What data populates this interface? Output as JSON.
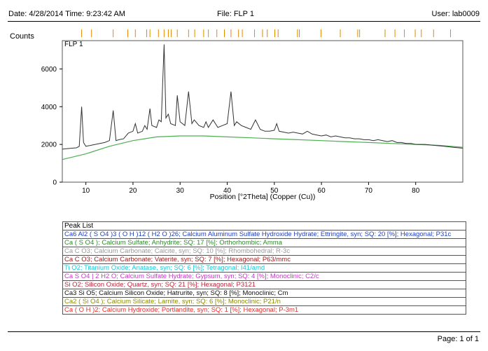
{
  "header": {
    "date": "Date: 4/28/2014 Time: 9:23:42 AM",
    "file": "File: FLP 1",
    "user": "User: lab0009"
  },
  "footer": {
    "page": "Page: 1 of 1"
  },
  "colors": {
    "pattern": "#333333",
    "background_curve": "#4caf50",
    "ref_ticks": "#e08a00",
    "axis": "#000000",
    "frame": "#555555"
  },
  "chart_data": {
    "type": "line",
    "title": "FLP 1",
    "ylabel": "Counts",
    "xlabel": "Position [°2Theta] (Copper (Cu))",
    "xlim": [
      5,
      90
    ],
    "ylim": [
      0,
      7500
    ],
    "xticks": [
      10,
      20,
      30,
      40,
      50,
      60,
      70,
      80
    ],
    "yticks": [
      0,
      2000,
      4000,
      6000
    ],
    "grid": false,
    "series": [
      {
        "x": [
          5,
          7,
          8,
          8.6,
          9.1,
          9.5,
          10,
          11,
          12,
          13,
          14,
          15,
          15.8,
          16.4,
          17,
          18,
          19,
          20,
          20.5,
          21,
          22,
          22.5,
          23,
          23.6,
          24,
          25,
          25.5,
          26,
          26.6,
          27,
          27.5,
          28,
          29,
          29.4,
          30,
          31,
          31.8,
          32.5,
          33,
          34,
          35,
          35.5,
          36,
          37,
          38,
          39,
          40,
          40.8,
          41.5,
          42,
          43,
          44,
          45,
          46,
          47,
          48,
          49,
          50,
          50.5,
          51,
          52,
          53,
          54,
          55,
          56,
          57,
          58,
          59,
          60,
          61,
          62,
          63,
          64,
          65,
          66,
          67,
          68,
          69,
          70,
          71,
          72,
          73,
          74,
          75,
          76,
          77,
          78,
          79,
          80,
          82,
          84,
          86,
          88,
          90
        ],
        "y": [
          1750,
          1800,
          1820,
          1900,
          4000,
          2100,
          1900,
          1950,
          2000,
          2050,
          2100,
          2200,
          3800,
          2200,
          2250,
          2300,
          2600,
          2700,
          3100,
          2600,
          2700,
          3000,
          2800,
          3900,
          3000,
          2900,
          3300,
          3200,
          7300,
          3400,
          3600,
          3100,
          3000,
          4600,
          3200,
          3000,
          4800,
          3100,
          3300,
          3000,
          2900,
          3200,
          2900,
          3300,
          2900,
          3000,
          3100,
          4800,
          3000,
          3200,
          3000,
          2900,
          2800,
          3300,
          2800,
          2700,
          2700,
          2750,
          3100,
          2700,
          2650,
          2600,
          2650,
          2600,
          2550,
          2700,
          2550,
          2500,
          2450,
          2500,
          2400,
          2450,
          2400,
          2350,
          2350,
          2300,
          2300,
          2250,
          2250,
          2200,
          2250,
          2200,
          2150,
          2200,
          2100,
          2100,
          2050,
          2050,
          2000,
          2000,
          1950,
          1900,
          1850,
          1800
        ]
      },
      {
        "x": [
          5,
          10,
          15,
          20,
          25,
          30,
          35,
          40,
          45,
          50,
          55,
          60,
          65,
          70,
          75,
          80,
          85,
          90
        ],
        "y": [
          1200,
          1500,
          1900,
          2200,
          2400,
          2450,
          2450,
          2400,
          2350,
          2300,
          2250,
          2200,
          2150,
          2100,
          2050,
          2000,
          1950,
          1850
        ]
      }
    ],
    "reference_ticks": [
      9.1,
      11.2,
      15.8,
      18.9,
      20.5,
      22.9,
      23.6,
      25.4,
      26.6,
      27.5,
      28.1,
      29.4,
      31.8,
      33.1,
      35.0,
      36.0,
      37.8,
      39.4,
      40.8,
      42.4,
      43.2,
      45.8,
      47.5,
      48.5,
      50.1,
      50.8,
      54.9,
      55.3,
      59.9,
      64.0,
      67.7,
      68.1,
      73.5,
      75.6,
      77.6,
      79.9,
      81.2,
      83.8,
      87.4
    ]
  },
  "peak_list": {
    "title": "Peak List",
    "rows": [
      {
        "text": "Ca6 Al2 ( S O4 )3 ( O H )12 ( H2 O )26; Calcium Aluminum Sulfate Hydroxide Hydrate; Ettringite, syn; SQ: 20 [%]; Hexagonal; P31c",
        "color": "#1f3fbf"
      },
      {
        "text": "Ca ( S O4 ); Calcium Sulfate; Anhydrite; SQ: 17 [%]; Orthorhombic; Amma",
        "color": "#2e8b2e"
      },
      {
        "text": "Ca C O3; Calcium Carbonate; Calcite, syn; SQ: 10 [%]; Rhombohedral; R-3c",
        "color": "#9a9a9a"
      },
      {
        "text": "Ca C O3; Calcium Carbonate; Vaterite, syn; SQ: 7 [%]; Hexagonal; P63/mmc",
        "color": "#9b1b1b"
      },
      {
        "text": "Ti O2; Titanium Oxide; Anatase, syn; SQ: 6 [%]; Tetragonal; I41/amd",
        "color": "#18c8d8"
      },
      {
        "text": "Ca S O4 | 2 H2 O; Calcium Sulfate Hydrate; Gypsum, syn; SQ: 4 [%]; Monoclinic; C2/c",
        "color": "#c23cc2"
      },
      {
        "text": "Si O2; Silicon Oxide; Quartz, syn; SQ: 21 [%]; Hexagonal; P3121",
        "color": "#b8263a"
      },
      {
        "text": "Ca3 Si O5; Calcium Silicon Oxide; Hatrurite, syn; SQ: 8 [%]; Monoclinic; Cm",
        "color": "#111111"
      },
      {
        "text": "Ca2 ( Si O4 ); Calcium Silicate; Larnite, syn; SQ: 6 [%]; Monoclinic; P21/n",
        "color": "#8c8c00"
      },
      {
        "text": "Ca ( O H )2; Calcium Hydroxide; Portlandite, syn; SQ: 1 [%]; Hexagonal; P-3m1",
        "color": "#e23030"
      }
    ]
  }
}
